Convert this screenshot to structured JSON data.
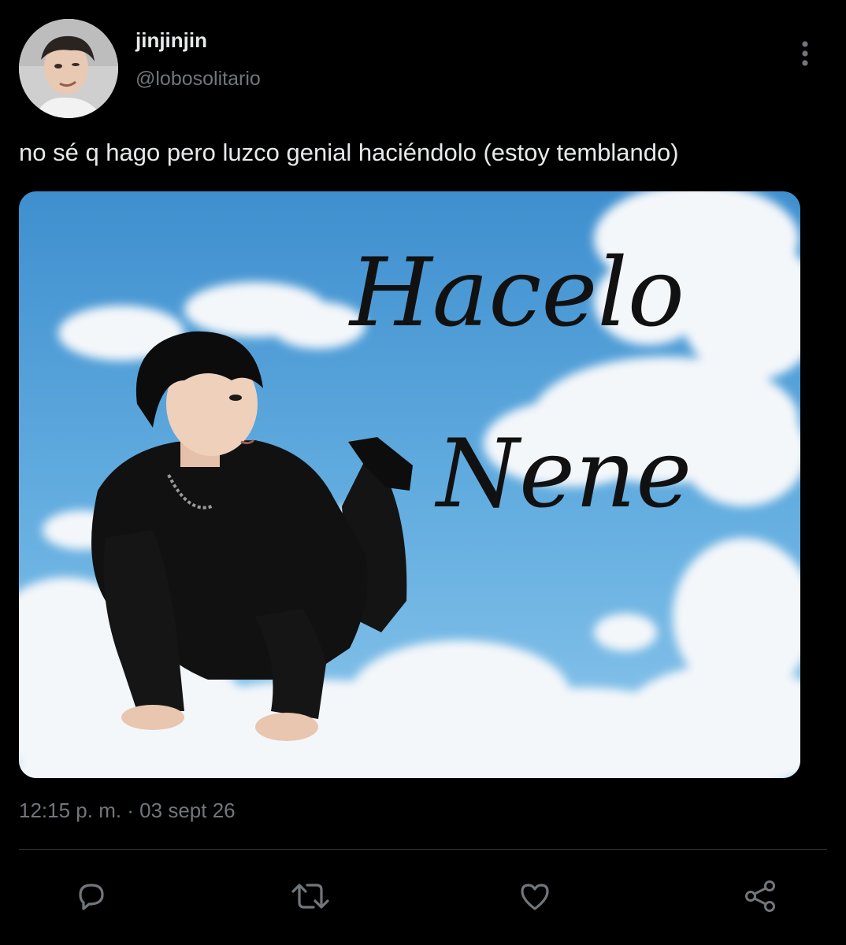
{
  "tweet": {
    "author": {
      "display_name": "jinjinjin",
      "handle": "@lobosolitario"
    },
    "text": "no sé q hago pero luzco genial haciéndolo (estoy temblando)",
    "media": {
      "overlay_line1": "Hacelo",
      "overlay_line2": "Nene"
    },
    "timestamp": "12:15 p. m. · 03 sept 26"
  },
  "actions": [
    {
      "icon": "reply-icon"
    },
    {
      "icon": "retweet-icon"
    },
    {
      "icon": "like-icon"
    },
    {
      "icon": "share-icon"
    }
  ],
  "colors": {
    "background": "#000000",
    "text_primary": "#e7e9ea",
    "text_secondary": "#71767b",
    "divider": "#2f3336",
    "icon": "#71767b"
  }
}
